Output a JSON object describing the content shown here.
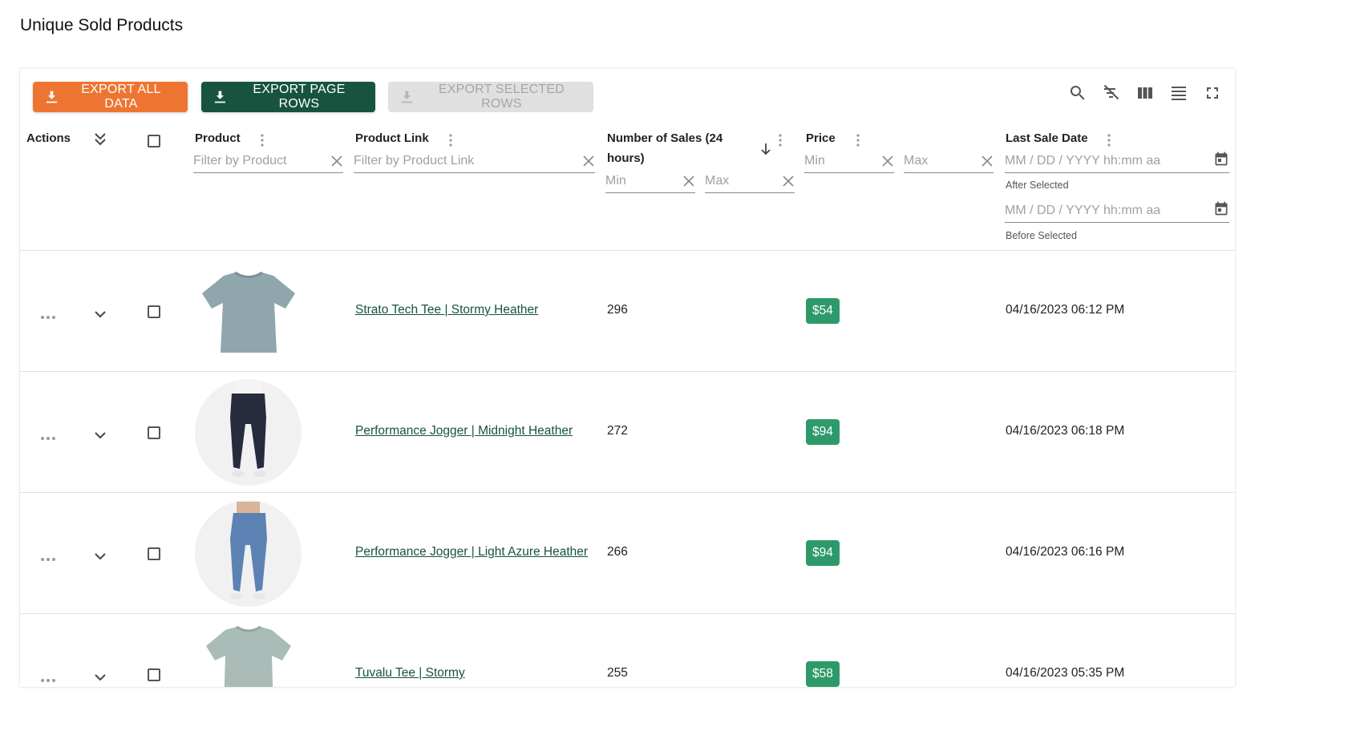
{
  "page": {
    "title": "Unique Sold Products"
  },
  "toolbar": {
    "export_all": "EXPORT ALL DATA",
    "export_page": "EXPORT PAGE ROWS",
    "export_selected": "EXPORT SELECTED ROWS",
    "icons": [
      "search-icon",
      "filter-off-icon",
      "columns-icon",
      "density-icon",
      "fullscreen-icon"
    ]
  },
  "columns": {
    "actions": "Actions",
    "product": {
      "label": "Product",
      "filter_placeholder": "Filter by Product"
    },
    "product_link": {
      "label": "Product Link",
      "filter_placeholder": "Filter by Product Link"
    },
    "sales": {
      "label_line1": "Number of Sales (24",
      "label_line2": "hours)",
      "min": "Min",
      "max": "Max"
    },
    "price": {
      "label": "Price",
      "min": "Min",
      "max": "Max"
    },
    "last_sale": {
      "label": "Last Sale Date",
      "after_placeholder": "MM / DD / YYYY hh:mm aa",
      "after_helper": "After Selected",
      "before_placeholder": "MM / DD / YYYY hh:mm aa",
      "before_helper": "Before Selected"
    }
  },
  "rows": [
    {
      "name": "Strato Tech Tee | Stormy Heather",
      "sales": "296",
      "price": "$54",
      "date": "04/16/2023 06:12 PM",
      "image": "tee"
    },
    {
      "name": "Performance Jogger | Midnight Heather",
      "sales": "272",
      "price": "$94",
      "date": "04/16/2023 06:18 PM",
      "image": "jogger-dark"
    },
    {
      "name": "Performance Jogger | Light Azure Heather",
      "sales": "266",
      "price": "$94",
      "date": "04/16/2023 06:16 PM",
      "image": "jogger-blue"
    },
    {
      "name": "Tuvalu Tee | Stormy",
      "sales": "255",
      "price": "$58",
      "date": "04/16/2023 05:35 PM",
      "image": "tee-light"
    }
  ],
  "colors": {
    "orange": "#ee7531",
    "dark_green": "#17533e",
    "price_green": "#2e9a6a"
  }
}
